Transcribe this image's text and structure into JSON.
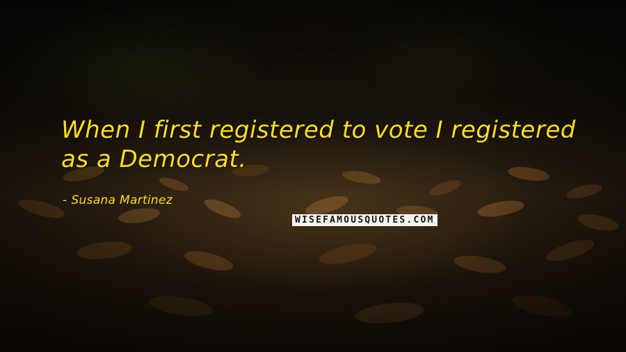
{
  "quote": {
    "text": "When I first registered to vote I registered as a Democrat.",
    "color": "#ffde1e"
  },
  "author": {
    "dash": "-",
    "name": "Susana Martinez"
  },
  "watermark": {
    "text": "WISEFAMOUSQUOTES.COM"
  },
  "background": {
    "description_colors": [
      "#15110a",
      "#2a1f12",
      "#8a5a24"
    ]
  }
}
